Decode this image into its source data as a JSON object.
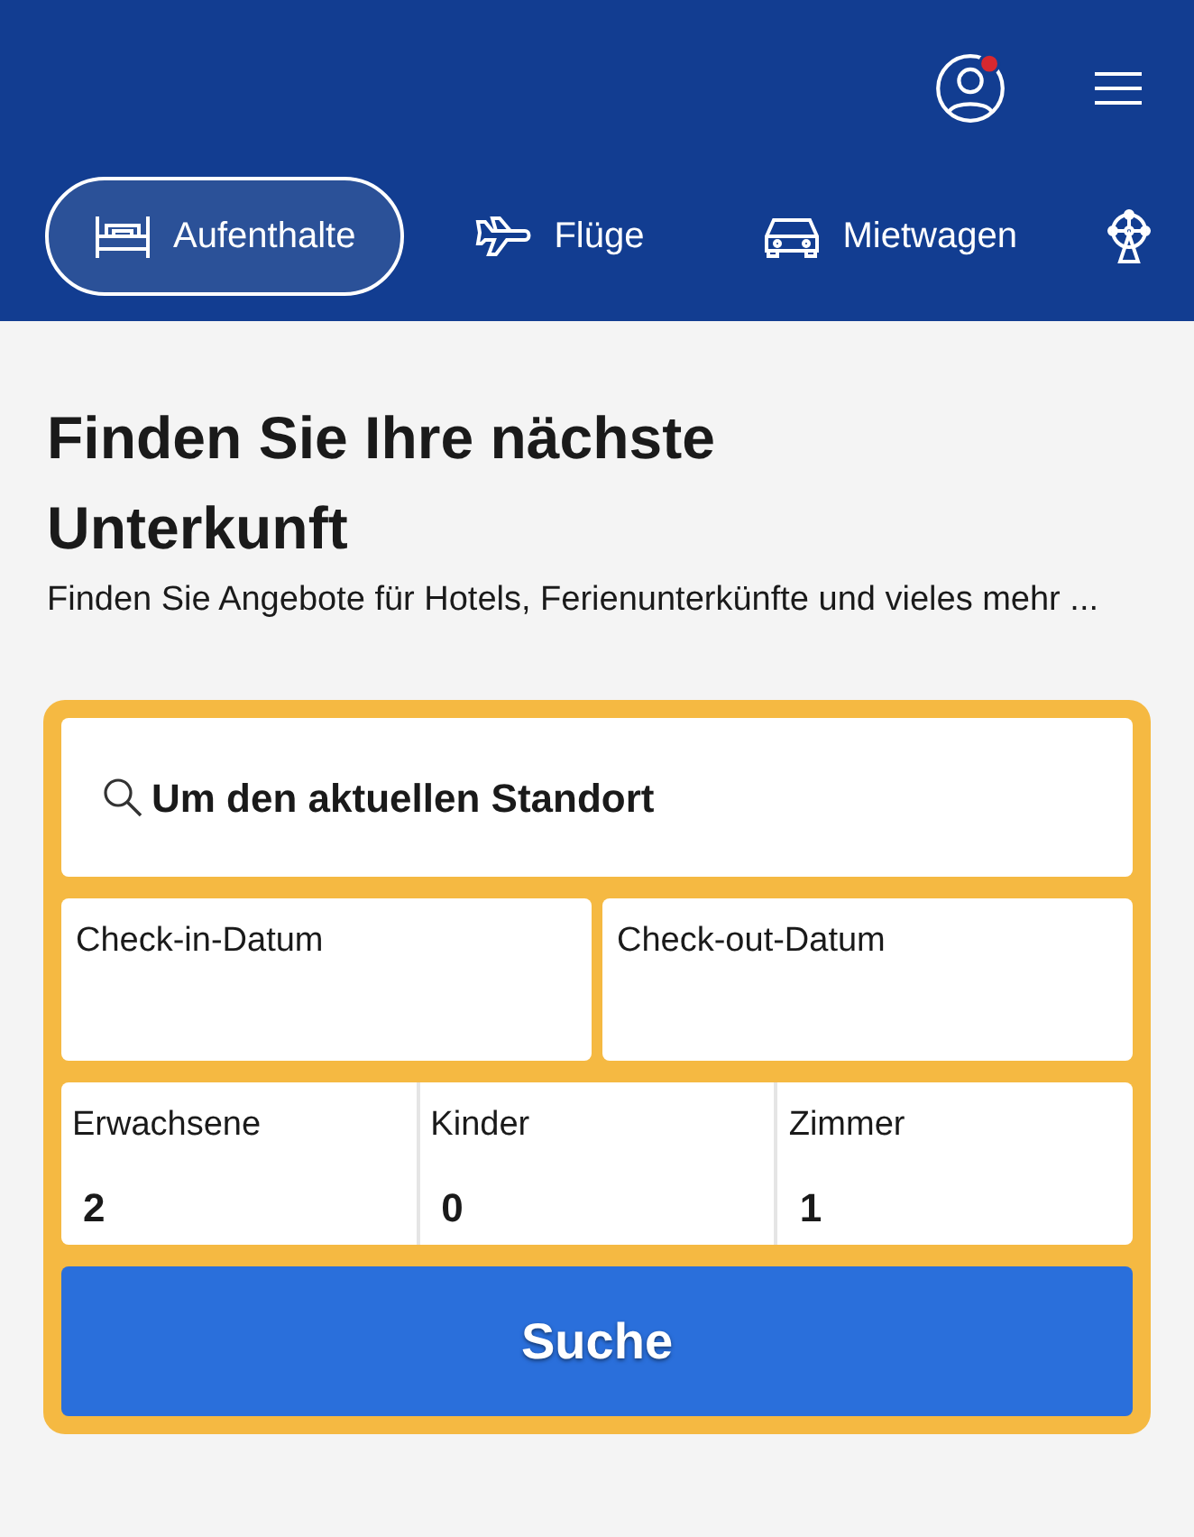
{
  "header": {
    "has_notification": true
  },
  "tabs": [
    {
      "kind": "bed",
      "label": "Aufenthalte",
      "selected": true
    },
    {
      "kind": "plane",
      "label": "Flüge",
      "selected": false
    },
    {
      "kind": "car",
      "label": "Mietwagen",
      "selected": false
    },
    {
      "kind": "ferris",
      "selected": false
    }
  ],
  "heading": "Finden Sie Ihre nächste Unterkunft",
  "subtitle": "Finden Sie Angebote für Hotels, Ferienunterkünfte und vieles mehr ...",
  "search": {
    "value": "Um den aktuellen Standort"
  },
  "dates": [
    {
      "label": "Check-in-Datum"
    },
    {
      "label": "Check-out-Datum"
    }
  ],
  "guests": [
    {
      "label": "Erwachsene",
      "value": "2"
    },
    {
      "label": "Kinder",
      "value": "0"
    },
    {
      "label": "Zimmer",
      "value": "1"
    }
  ],
  "button": "Suche"
}
